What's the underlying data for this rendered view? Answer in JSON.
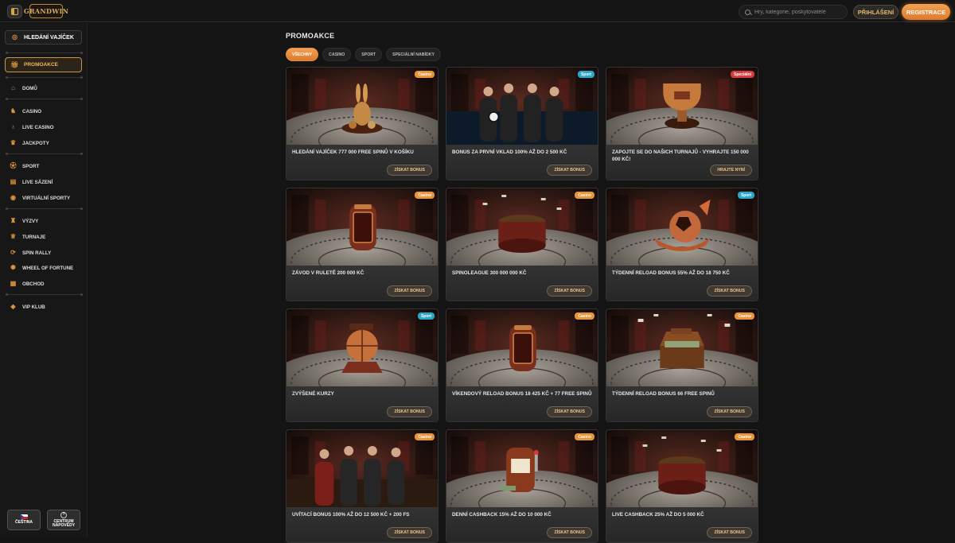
{
  "header": {
    "logo_text": "GRANDWIN",
    "search_placeholder": "Hry, kategorie, poskytovatelé",
    "login_label": "PŘIHLÁŠENÍ",
    "register_label": "REGISTRACE"
  },
  "sidebar": {
    "egg_hunt": "HLEDÁNÍ VAJÍČEK",
    "promotions": "PROMOAKCE",
    "home": "DOMŮ",
    "casino": "CASINO",
    "live_casino": "LIVE CASINO",
    "jackpots": "JACKPOTY",
    "sport": "SPORT",
    "live_betting": "LIVE SÁZENÍ",
    "virtual_sports": "VIRTUÁLNÍ SPORTY",
    "challenges": "VÝZVY",
    "tournaments": "TURNAJE",
    "spin_rally": "SPIN RALLY",
    "wheel_of_fortune": "WHEEL OF FORTUNE",
    "shop": "OBCHOD",
    "vip_club": "VIP KLUB",
    "language": "ČEŠTINA",
    "help_line1": "CENTRUM",
    "help_line2": "NÁPOVĚDY"
  },
  "main": {
    "title": "PROMOAKCE",
    "filters": [
      "VŠECHNY",
      "CASINO",
      "SPORT",
      "SPECIÁLNÍ NABÍDKY"
    ]
  },
  "cards": [
    {
      "title": "HLEDÁNÍ VAJÍČEK 777 000 FREE SPINŮ V KOŠÍKU",
      "badge": "Casino",
      "cta": "ZÍSKAT BONUS"
    },
    {
      "title": "BONUS ZA PRVNÍ VKLAD 100% AŽ DO 2 500 KČ",
      "badge": "Sport",
      "cta": "ZÍSKAT BONUS"
    },
    {
      "title": "ZAPOJTE SE DO NAŠICH TURNAJŮ - VYHRAJTE 150 000 000 KČ!",
      "badge": "Speciální",
      "cta": "HRAJTE NYNÍ"
    },
    {
      "title": "ZÁVOD V RULETĚ 200 000 KČ",
      "badge": "Casino",
      "cta": "ZÍSKAT BONUS"
    },
    {
      "title": "SPINOLEAGUE 300 000 000 KČ",
      "badge": "Casino",
      "cta": "ZÍSKAT BONUS"
    },
    {
      "title": "TÝDENNÍ RELOAD BONUS 55% AŽ DO 18 750 KČ",
      "badge": "Sport",
      "cta": "ZÍSKAT BONUS"
    },
    {
      "title": "ZVÝŠENÉ KURZY",
      "badge": "Sport",
      "cta": "ZÍSKAT BONUS"
    },
    {
      "title": "VÍKENDOVÝ RELOAD BONUS 18 425 KČ + 77 FREE SPINŮ",
      "badge": "Casino",
      "cta": "ZÍSKAT BONUS"
    },
    {
      "title": "TÝDENNÍ RELOAD BONUS 66 FREE SPINŮ",
      "badge": "Casino",
      "cta": "ZÍSKAT BONUS"
    },
    {
      "title": "UVÍTACÍ BONUS 100% AŽ DO 12 500 KČ + 200 FS",
      "badge": "Casino",
      "cta": "ZÍSKAT BONUS"
    },
    {
      "title": "DENNÍ CASHBACK 15% AŽ DO 10 000 KČ",
      "badge": "Casino",
      "cta": "ZÍSKAT BONUS"
    },
    {
      "title": "LIVE CASHBACK 25% AŽ DO 5 000 KČ",
      "badge": "Casino",
      "cta": "ZÍSKAT BONUS"
    }
  ],
  "colors": {
    "accent": "#e58b3c",
    "gold": "#d9a24c",
    "badge_casino": "#e7943a",
    "badge_sport": "#2aa7c9",
    "badge_special": "#d43b3b"
  }
}
